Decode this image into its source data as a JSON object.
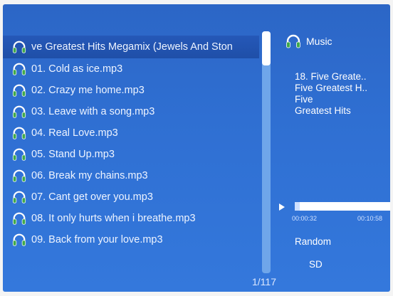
{
  "playlist": {
    "items": [
      {
        "label": "ve Greatest Hits Megamix (Jewels And Ston",
        "selected": true
      },
      {
        "label": "01. Cold as ice.mp3",
        "selected": false
      },
      {
        "label": "02. Crazy me home.mp3",
        "selected": false
      },
      {
        "label": "03. Leave with a song.mp3",
        "selected": false
      },
      {
        "label": "04. Real Love.mp3",
        "selected": false
      },
      {
        "label": "05. Stand Up.mp3",
        "selected": false
      },
      {
        "label": "06. Break my chains.mp3",
        "selected": false
      },
      {
        "label": "07. Cant get over you.mp3",
        "selected": false
      },
      {
        "label": "08. It only hurts when i breathe.mp3",
        "selected": false
      },
      {
        "label": "09. Back from your love.mp3",
        "selected": false
      }
    ],
    "item_icon": "headphones-icon",
    "page_counter": "1/117"
  },
  "panel": {
    "title": "Music",
    "title_icon": "headphones-icon",
    "info_lines": [
      "18. Five Greate..",
      "Five Greatest H..",
      "Five",
      "Greatest Hits"
    ],
    "play_icon": "play-icon",
    "progress_fraction": 0.05,
    "time_current": "00:00:32",
    "time_total": "00:10:58",
    "mode": "Random",
    "source": "SD"
  },
  "colors": {
    "background": "#2f6fd2",
    "selection": "#1f4fa8",
    "icon_green": "#3fa84a",
    "text": "#ffffff"
  }
}
